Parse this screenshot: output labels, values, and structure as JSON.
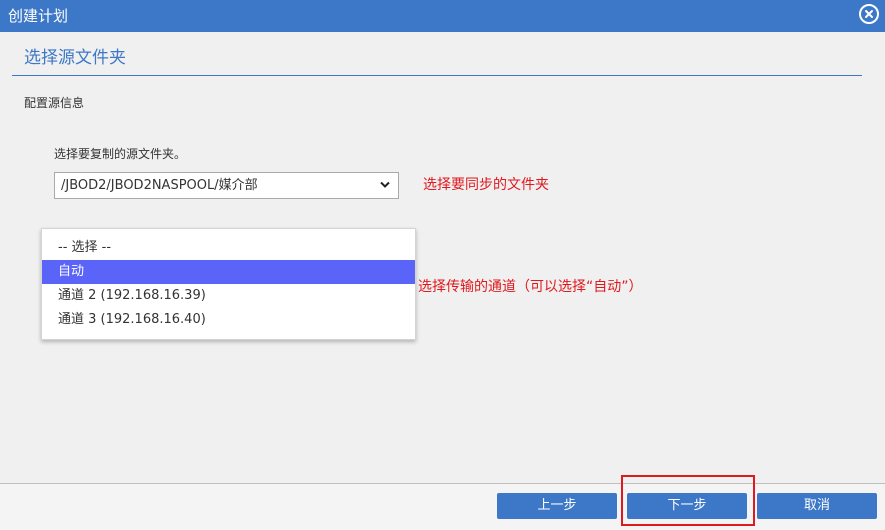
{
  "window": {
    "title": "创建计划"
  },
  "section": {
    "title": "选择源文件夹"
  },
  "config": {
    "heading": "配置源信息"
  },
  "source": {
    "prompt": "选择要复制的源文件夹。",
    "selected_folder": "/JBOD2/JBOD2NASPOOL/媒介部"
  },
  "channel": {
    "options": [
      "-- 选择 --",
      "自动",
      "通道 2 (192.168.16.39)",
      "通道 3 (192.168.16.40)"
    ],
    "selected": "自动"
  },
  "annotations": {
    "folder_note": "选择要同步的文件夹",
    "channel_note": "选择传输的通道（可以选择“自动”）"
  },
  "footer": {
    "prev_label": "上一步",
    "next_label": "下一步",
    "cancel_label": "取消"
  },
  "colors": {
    "accent": "#3d78c8",
    "selection": "#5b64f8",
    "annotation": "#e0191e"
  },
  "icons": {
    "close": "close-circle-icon",
    "dropdown": "chevron-down-icon"
  }
}
